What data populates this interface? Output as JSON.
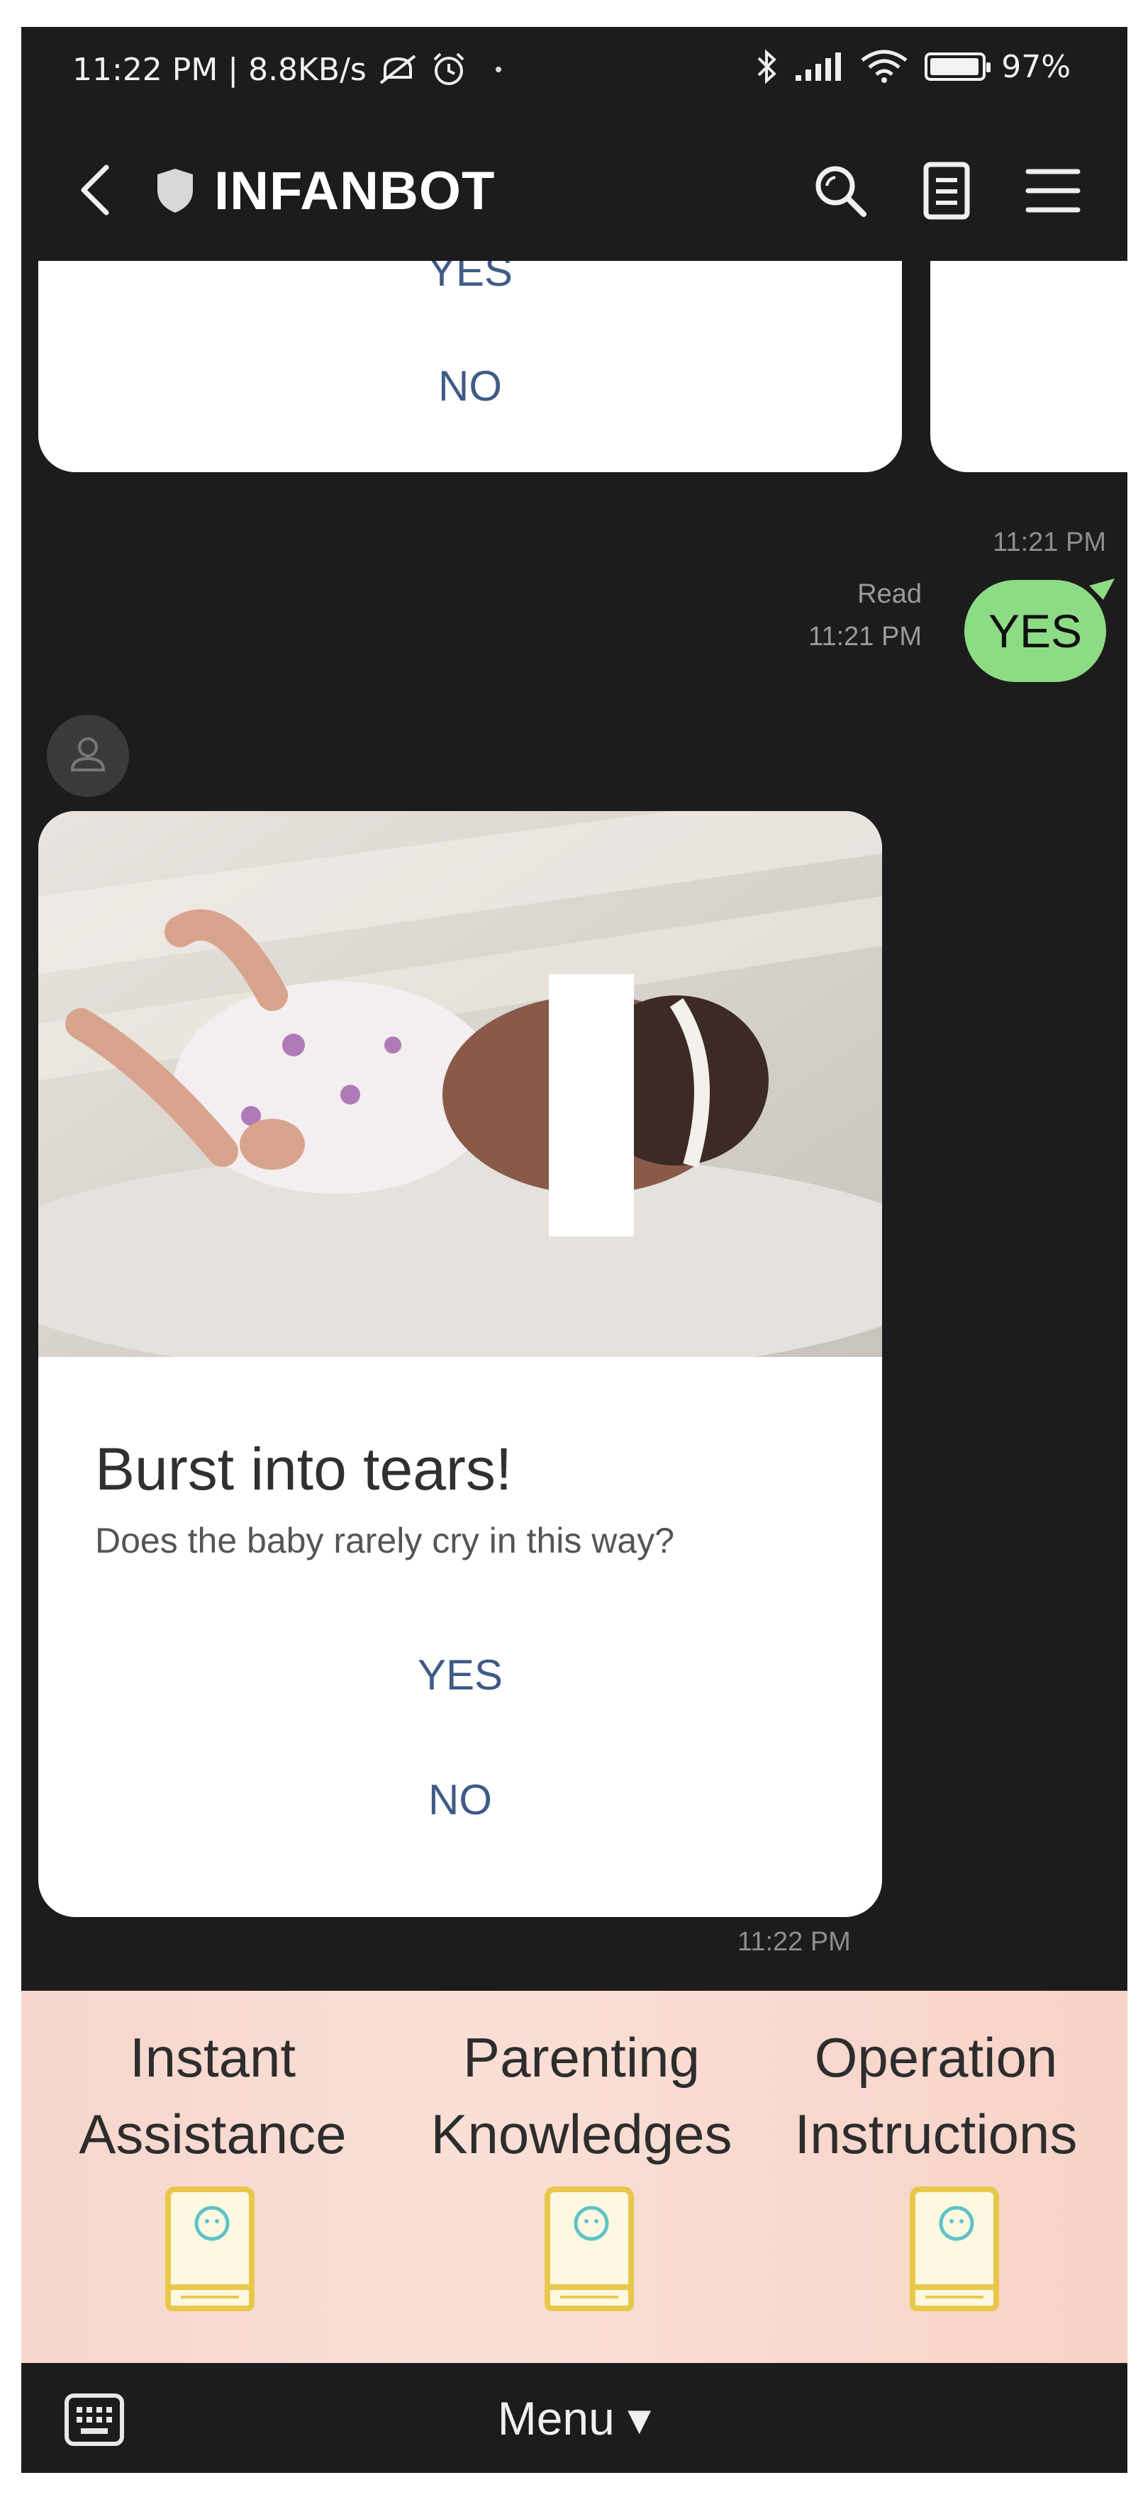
{
  "status_bar": {
    "time_speed": "11:22 PM | 8.8KB/s",
    "battery": "97%",
    "icons": [
      "mute-icon",
      "alarm-icon",
      "dot-icon",
      "bluetooth-icon",
      "signal-icon",
      "wifi-icon",
      "battery-icon"
    ]
  },
  "header": {
    "title": "INFANBOT",
    "icons": [
      "back-arrow-icon",
      "shield-icon",
      "search-icon",
      "notes-icon",
      "hamburger-menu-icon"
    ]
  },
  "chat": {
    "prev_card": {
      "yes_partial": "YES",
      "no_label": "NO",
      "timestamp": "11:21 PM"
    },
    "user_message": {
      "text": "YES",
      "status": "Read",
      "timestamp": "11:21 PM",
      "color": "#8ddc85"
    },
    "bot_card": {
      "title": "Burst into tears!",
      "subtitle": "Does the baby rarely cry in this way?",
      "yes_label": "YES",
      "no_label": "NO",
      "timestamp": "11:22 PM"
    }
  },
  "rich_menu": {
    "items": [
      {
        "line1": "Instant",
        "line2": "Assistance",
        "icon": "book-icon"
      },
      {
        "line1": "Parenting",
        "line2": "Knowledges",
        "icon": "book-icon"
      },
      {
        "line1": "Operation",
        "line2": "Instructions",
        "icon": "book-icon"
      }
    ],
    "accent": "#e8c84a"
  },
  "bottom_bar": {
    "menu_label": "Menu ▾",
    "icon": "keyboard-icon"
  }
}
